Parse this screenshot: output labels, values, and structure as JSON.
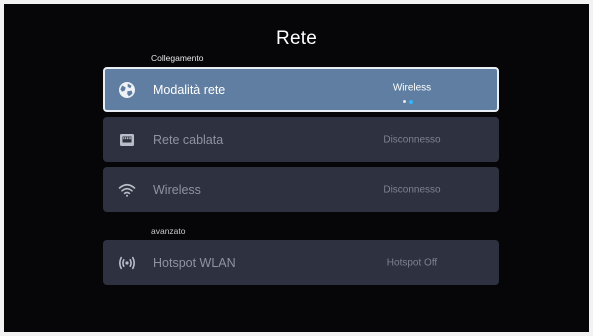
{
  "header": {
    "title": "Rete"
  },
  "sections": {
    "connection": "Collegamento",
    "advanced": "avanzato"
  },
  "rows": {
    "network_mode": {
      "label": "Modalità rete",
      "value": "Wireless",
      "icon": "globe-icon",
      "selected": true,
      "option_count": 2,
      "selected_option_index": 1
    },
    "wired_network": {
      "label": "Rete cablata",
      "value": "Disconnesso",
      "icon": "ethernet-icon"
    },
    "wireless": {
      "label": "Wireless",
      "value": "Disconnesso",
      "icon": "wifi-icon"
    },
    "hotspot": {
      "label": "Hotspot WLAN",
      "value": "Hotspot Off",
      "icon": "hotspot-icon"
    }
  },
  "colors": {
    "background": "#060608",
    "row": "#2e3240",
    "row_selected": "#5f7ea1",
    "focus_border": "#e9eef5",
    "indicator_active": "#2fb7ff"
  }
}
